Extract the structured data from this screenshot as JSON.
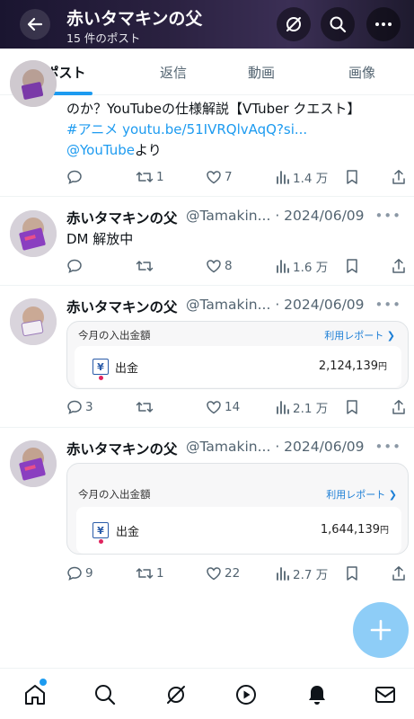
{
  "header": {
    "title": "赤いタマキンの父",
    "subtitle": "15 件のポスト"
  },
  "tabs": [
    {
      "label": "ポスト",
      "active": true
    },
    {
      "label": "返信",
      "active": false
    },
    {
      "label": "動画",
      "active": false
    },
    {
      "label": "画像",
      "active": false
    }
  ],
  "posts": [
    {
      "text_line1": "のか？YouTubeの仕様解説【VTuber クエスト】",
      "hashtag": "#アニメ",
      "link": "youtu.be/51IVRQlvAqQ?si...",
      "mention": "@YouTube",
      "mention_suffix": "より",
      "replies": "",
      "reposts": "1",
      "likes": "7",
      "views": "1.4 万"
    },
    {
      "name": "赤いタマキンの父",
      "handle": "@Tamakin...",
      "date": "· 2024/06/09",
      "text": "DM 解放中",
      "replies": "",
      "reposts": "",
      "likes": "8",
      "views": "1.6 万"
    },
    {
      "name": "赤いタマキンの父",
      "handle": "@Tamakin...",
      "date": "· 2024/06/09",
      "card": {
        "title": "今月の入出金額",
        "link": "利用レポート",
        "row_label": "出金",
        "amount": "2,124,139",
        "currency": "円"
      },
      "replies": "3",
      "reposts": "",
      "likes": "14",
      "views": "2.1 万"
    },
    {
      "name": "赤いタマキンの父",
      "handle": "@Tamakin...",
      "date": "· 2024/06/09",
      "card": {
        "title": "今月の入出金額",
        "link": "利用レポート",
        "row_label": "出金",
        "amount": "1,644,139",
        "currency": "円"
      },
      "replies": "9",
      "reposts": "1",
      "likes": "22",
      "views": "2.7 万"
    }
  ],
  "more_glyph": "•••",
  "yen_glyph": "¥",
  "colors": {
    "accent": "#1d9bf0",
    "fab": "#8ecdf7",
    "muted": "#536471"
  }
}
